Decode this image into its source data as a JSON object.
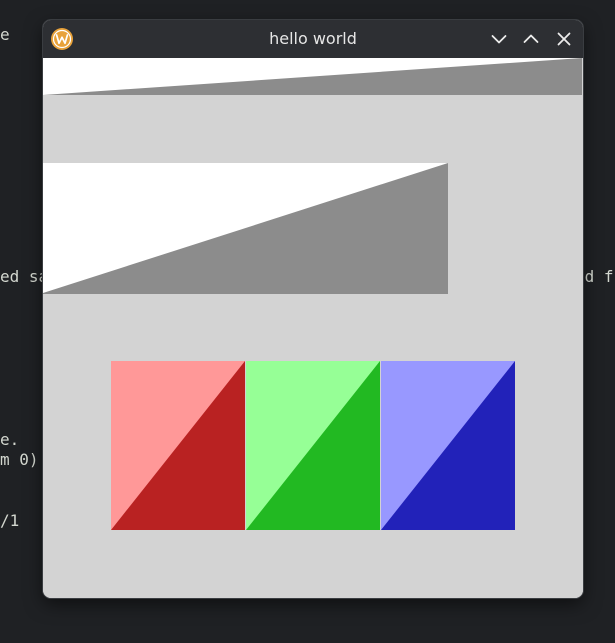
{
  "terminal": {
    "lines": [
      "e",
      "ed sa",
      "nd f",
      "e.",
      "m 0)",
      "/1"
    ]
  },
  "window": {
    "title": "hello world",
    "app_icon": "w-logo-icon",
    "controls": [
      "minimize-icon",
      "maximize-icon",
      "close-icon"
    ]
  },
  "canvas": {
    "background_color": "#d3d3d3",
    "white_color": "#ffffff",
    "gray_color": "#8c8c8c",
    "squares": [
      {
        "name": "red",
        "light": "#ff9898",
        "dark": "#b92222"
      },
      {
        "name": "green",
        "light": "#96ff96",
        "dark": "#22b922"
      },
      {
        "name": "blue",
        "light": "#9898ff",
        "dark": "#2222b9"
      }
    ]
  }
}
